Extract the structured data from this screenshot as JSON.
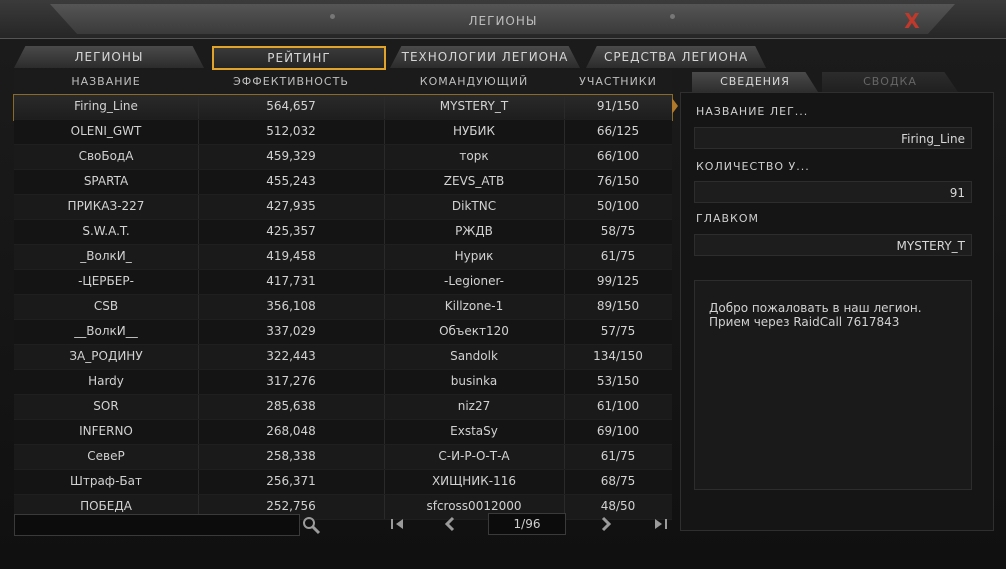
{
  "window": {
    "title": "ЛЕГИОНЫ",
    "close_label": "X"
  },
  "tabs": [
    "ЛЕГИОНЫ",
    "РЕЙТИНГ",
    "ТЕХНОЛОГИИ ЛЕГИОНА",
    "СРЕДСТВА ЛЕГИОНА"
  ],
  "table": {
    "headers": [
      "НАЗВАНИЕ",
      "ЭФФЕКТИВНОСТЬ",
      "КОМАНДУЮЩИЙ",
      "УЧАСТНИКИ"
    ],
    "rows": [
      [
        "Firing_Line",
        "564,657",
        "MYSTERY_T",
        "91/150"
      ],
      [
        "OLENI_GWT",
        "512,032",
        "НУБИК",
        "66/125"
      ],
      [
        "СвоБодА",
        "459,329",
        "торк",
        "66/100"
      ],
      [
        "SPARTA",
        "455,243",
        "ZEVS_ATB",
        "76/150"
      ],
      [
        "ПРИКАЗ-227",
        "427,935",
        "DikTNC",
        "50/100"
      ],
      [
        "S.W.A.T.",
        "425,357",
        "РЖДВ",
        "58/75"
      ],
      [
        "_ВолкИ_",
        "419,458",
        "Нурик",
        "61/75"
      ],
      [
        "-ЦЕРБЕР-",
        "417,731",
        "-Legioner-",
        "99/125"
      ],
      [
        "CSB",
        "356,108",
        "Killzone-1",
        "89/150"
      ],
      [
        "__ВолкИ__",
        "337,029",
        "Объект120",
        "57/75"
      ],
      [
        "ЗА_РОДИНУ",
        "322,443",
        "Sandolk",
        "134/150"
      ],
      [
        "Hardy",
        "317,276",
        "businka",
        "53/150"
      ],
      [
        "SOR",
        "285,638",
        "niz27",
        "61/100"
      ],
      [
        "INFERNO",
        "268,048",
        "ExstaSy",
        "69/100"
      ],
      [
        "СевеР",
        "258,338",
        "С-И-Р-О-Т-А",
        "61/75"
      ],
      [
        "Штраф-Бат",
        "256,371",
        "ХИЩНИК-116",
        "68/75"
      ],
      [
        "ПОБЕДА",
        "252,756",
        "sfcross0012000",
        "48/50"
      ]
    ]
  },
  "pager": {
    "page": "1/96",
    "first": "|<",
    "prev": "<",
    "next": ">",
    "last": ">|"
  },
  "search": {
    "placeholder": ""
  },
  "side": {
    "tabs": [
      "СВЕДЕНИЯ",
      "СВОДКА"
    ],
    "fields": [
      {
        "label": "НАЗВАНИЕ ЛЕГ...",
        "value": "Firing_Line"
      },
      {
        "label": "КОЛИЧЕСТВО У...",
        "value": "91"
      },
      {
        "label": "ГЛАВКОМ",
        "value": "MYSTERY_T"
      }
    ],
    "description": "Добро пожаловать в наш легион.\nПрием через RaidCall 7617843"
  },
  "colors": {
    "accent": "#e2a32a",
    "close": "#c0392b"
  }
}
